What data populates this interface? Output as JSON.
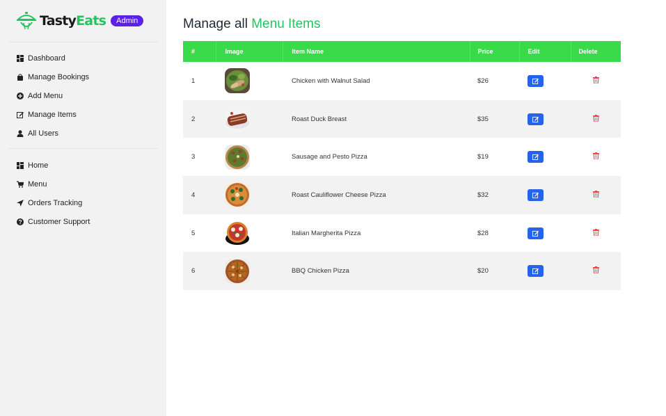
{
  "brand": {
    "name_part1": "Tasty",
    "name_part2": "Eats",
    "badge": "Admin"
  },
  "sidebar": {
    "admin_items": [
      {
        "label": "Dashboard",
        "icon": "dashboard-icon"
      },
      {
        "label": "Manage Bookings",
        "icon": "shopping-bag-icon"
      },
      {
        "label": "Add Menu",
        "icon": "plus-circle-icon"
      },
      {
        "label": "Manage Items",
        "icon": "edit-icon"
      },
      {
        "label": "All Users",
        "icon": "user-icon"
      }
    ],
    "site_items": [
      {
        "label": "Home",
        "icon": "dashboard-icon"
      },
      {
        "label": "Menu",
        "icon": "cart-icon"
      },
      {
        "label": "Orders Tracking",
        "icon": "location-arrow-icon"
      },
      {
        "label": "Customer Support",
        "icon": "question-circle-icon"
      }
    ]
  },
  "main": {
    "title_part1": "Manage all ",
    "title_part2": "Menu Items",
    "table": {
      "headers": [
        "#",
        "Image",
        "Item Name",
        "Price",
        "Edit",
        "Delete"
      ],
      "rows": [
        {
          "num": "1",
          "name": "Chicken with Walnut Salad",
          "price": "$26"
        },
        {
          "num": "2",
          "name": "Roast Duck Breast",
          "price": "$35"
        },
        {
          "num": "3",
          "name": "Sausage and Pesto Pizza",
          "price": "$19"
        },
        {
          "num": "4",
          "name": "Roast Cauliflower Cheese Pizza",
          "price": "$32"
        },
        {
          "num": "5",
          "name": "Italian Margherita Pizza",
          "price": "$28"
        },
        {
          "num": "6",
          "name": "BBQ Chicken Pizza",
          "price": "$20"
        }
      ]
    }
  },
  "colors": {
    "accent": "#39db4a",
    "badge": "#5b21e6",
    "edit": "#2563eb",
    "delete": "#ef4444"
  }
}
